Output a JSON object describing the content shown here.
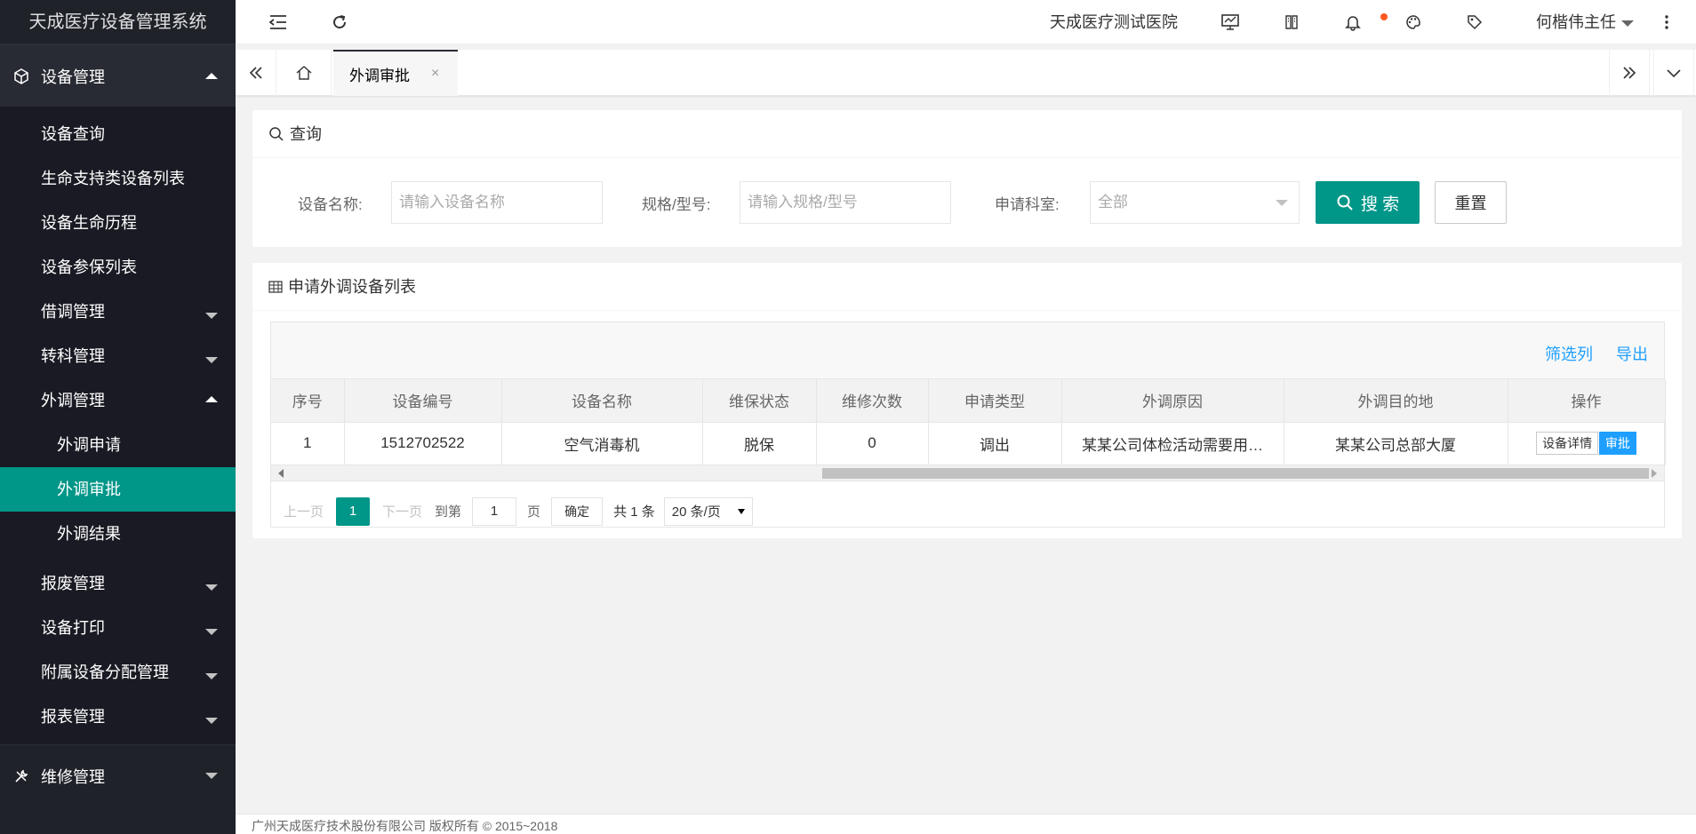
{
  "app": {
    "title": "天成医疗设备管理系统"
  },
  "sidebar": {
    "group1": {
      "label": "设备管理",
      "icon": "cube-icon"
    },
    "items": [
      {
        "label": "设备查询"
      },
      {
        "label": "生命支持类设备列表"
      },
      {
        "label": "设备生命历程"
      },
      {
        "label": "设备参保列表"
      },
      {
        "label": "借调管理"
      },
      {
        "label": "转科管理"
      },
      {
        "label": "外调管理"
      }
    ],
    "sub_items": [
      {
        "label": "外调申请"
      },
      {
        "label": "外调审批"
      },
      {
        "label": "外调结果"
      }
    ],
    "more_items": [
      {
        "label": "报废管理"
      },
      {
        "label": "设备打印"
      },
      {
        "label": "附属设备分配管理"
      },
      {
        "label": "报表管理"
      }
    ],
    "group2": {
      "label": "维修管理",
      "icon": "wrench-icon"
    }
  },
  "header": {
    "hospital": "天成医疗测试医院",
    "user": "何楷伟主任"
  },
  "tabs": {
    "active_label": "外调审批",
    "close": "×"
  },
  "search": {
    "title": "查询",
    "name_label": "设备名称:",
    "name_placeholder": "请输入设备名称",
    "spec_label": "规格/型号:",
    "spec_placeholder": "请输入规格/型号",
    "dept_label": "申请科室:",
    "dept_value": "全部",
    "search_btn": "搜 索",
    "reset_btn": "重置"
  },
  "list": {
    "title": "申请外调设备列表",
    "filter_cols": "筛选列",
    "export": "导出",
    "columns": [
      "序号",
      "设备编号",
      "设备名称",
      "维保状态",
      "维修次数",
      "申请类型",
      "外调原因",
      "外调目的地",
      "操作"
    ],
    "rows": [
      {
        "index": "1",
        "code": "1512702522",
        "name": "空气消毒机",
        "warranty": "脱保",
        "repairs": "0",
        "type": "调出",
        "reason": "某某公司体检活动需要用…",
        "destination": "某某公司总部大厦",
        "btn_detail": "设备详情",
        "btn_approve": "审批"
      }
    ]
  },
  "pager": {
    "prev": "上一页",
    "current": "1",
    "next": "下一页",
    "goto": "到第",
    "page_input": "1",
    "page_unit": "页",
    "confirm": "确定",
    "total": "共 1 条",
    "per_page": "20 条/页"
  },
  "footer": {
    "text": "广州天成医疗技术股份有限公司 版权所有 © 2015~2018"
  },
  "colors": {
    "primary": "#009688",
    "link": "#1e9fff",
    "sidebar": "#20222a",
    "badge": "#ff5722"
  }
}
